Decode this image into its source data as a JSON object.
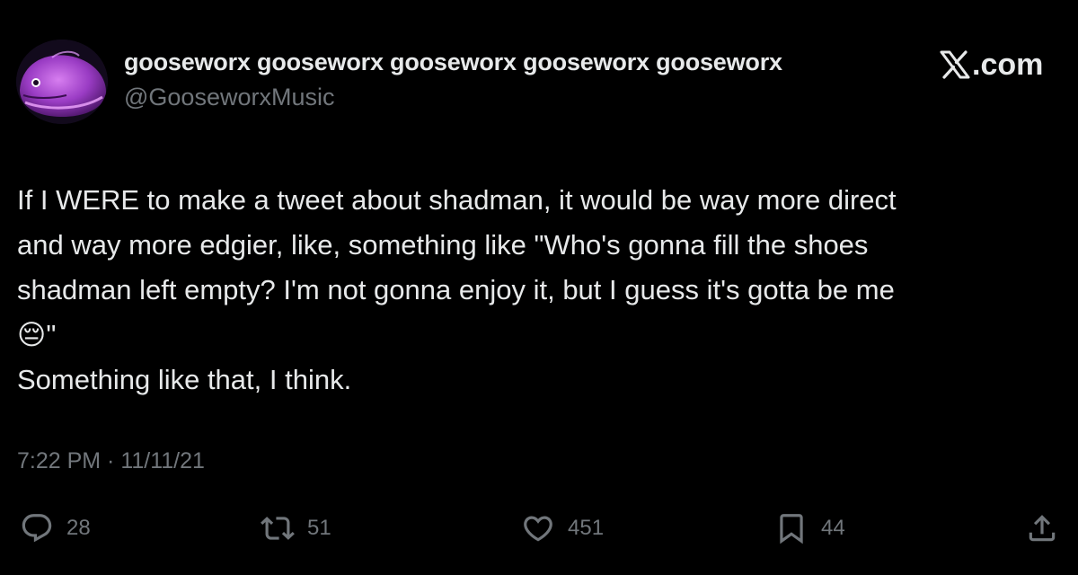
{
  "author": {
    "display_name": "gooseworx gooseworx gooseworx gooseworx gooseworx",
    "handle": "@GooseworxMusic"
  },
  "site_badge": {
    "label": ".com",
    "logo": "x-logo-icon"
  },
  "tweet": {
    "text": "If I WERE to make a tweet about shadman, it would be way more direct\nand way more edgier, like, something like \"Who's gonna fill the shoes\nshadman left empty? I'm not gonna enjoy it, but I guess it's gotta be me\n😔\"\nSomething like that, I think.",
    "timestamp": "7:22 PM · 11/11/21"
  },
  "stats": {
    "replies": "28",
    "retweets": "51",
    "likes": "451",
    "bookmarks": "44"
  },
  "icons": {
    "reply": "reply-icon",
    "retweet": "retweet-icon",
    "like": "heart-icon",
    "bookmark": "bookmark-icon",
    "share": "share-icon"
  },
  "colors": {
    "background": "#000000",
    "primary_text": "#e7e9ea",
    "secondary_text": "#71767b",
    "avatar_accent": "#b34bd6"
  }
}
